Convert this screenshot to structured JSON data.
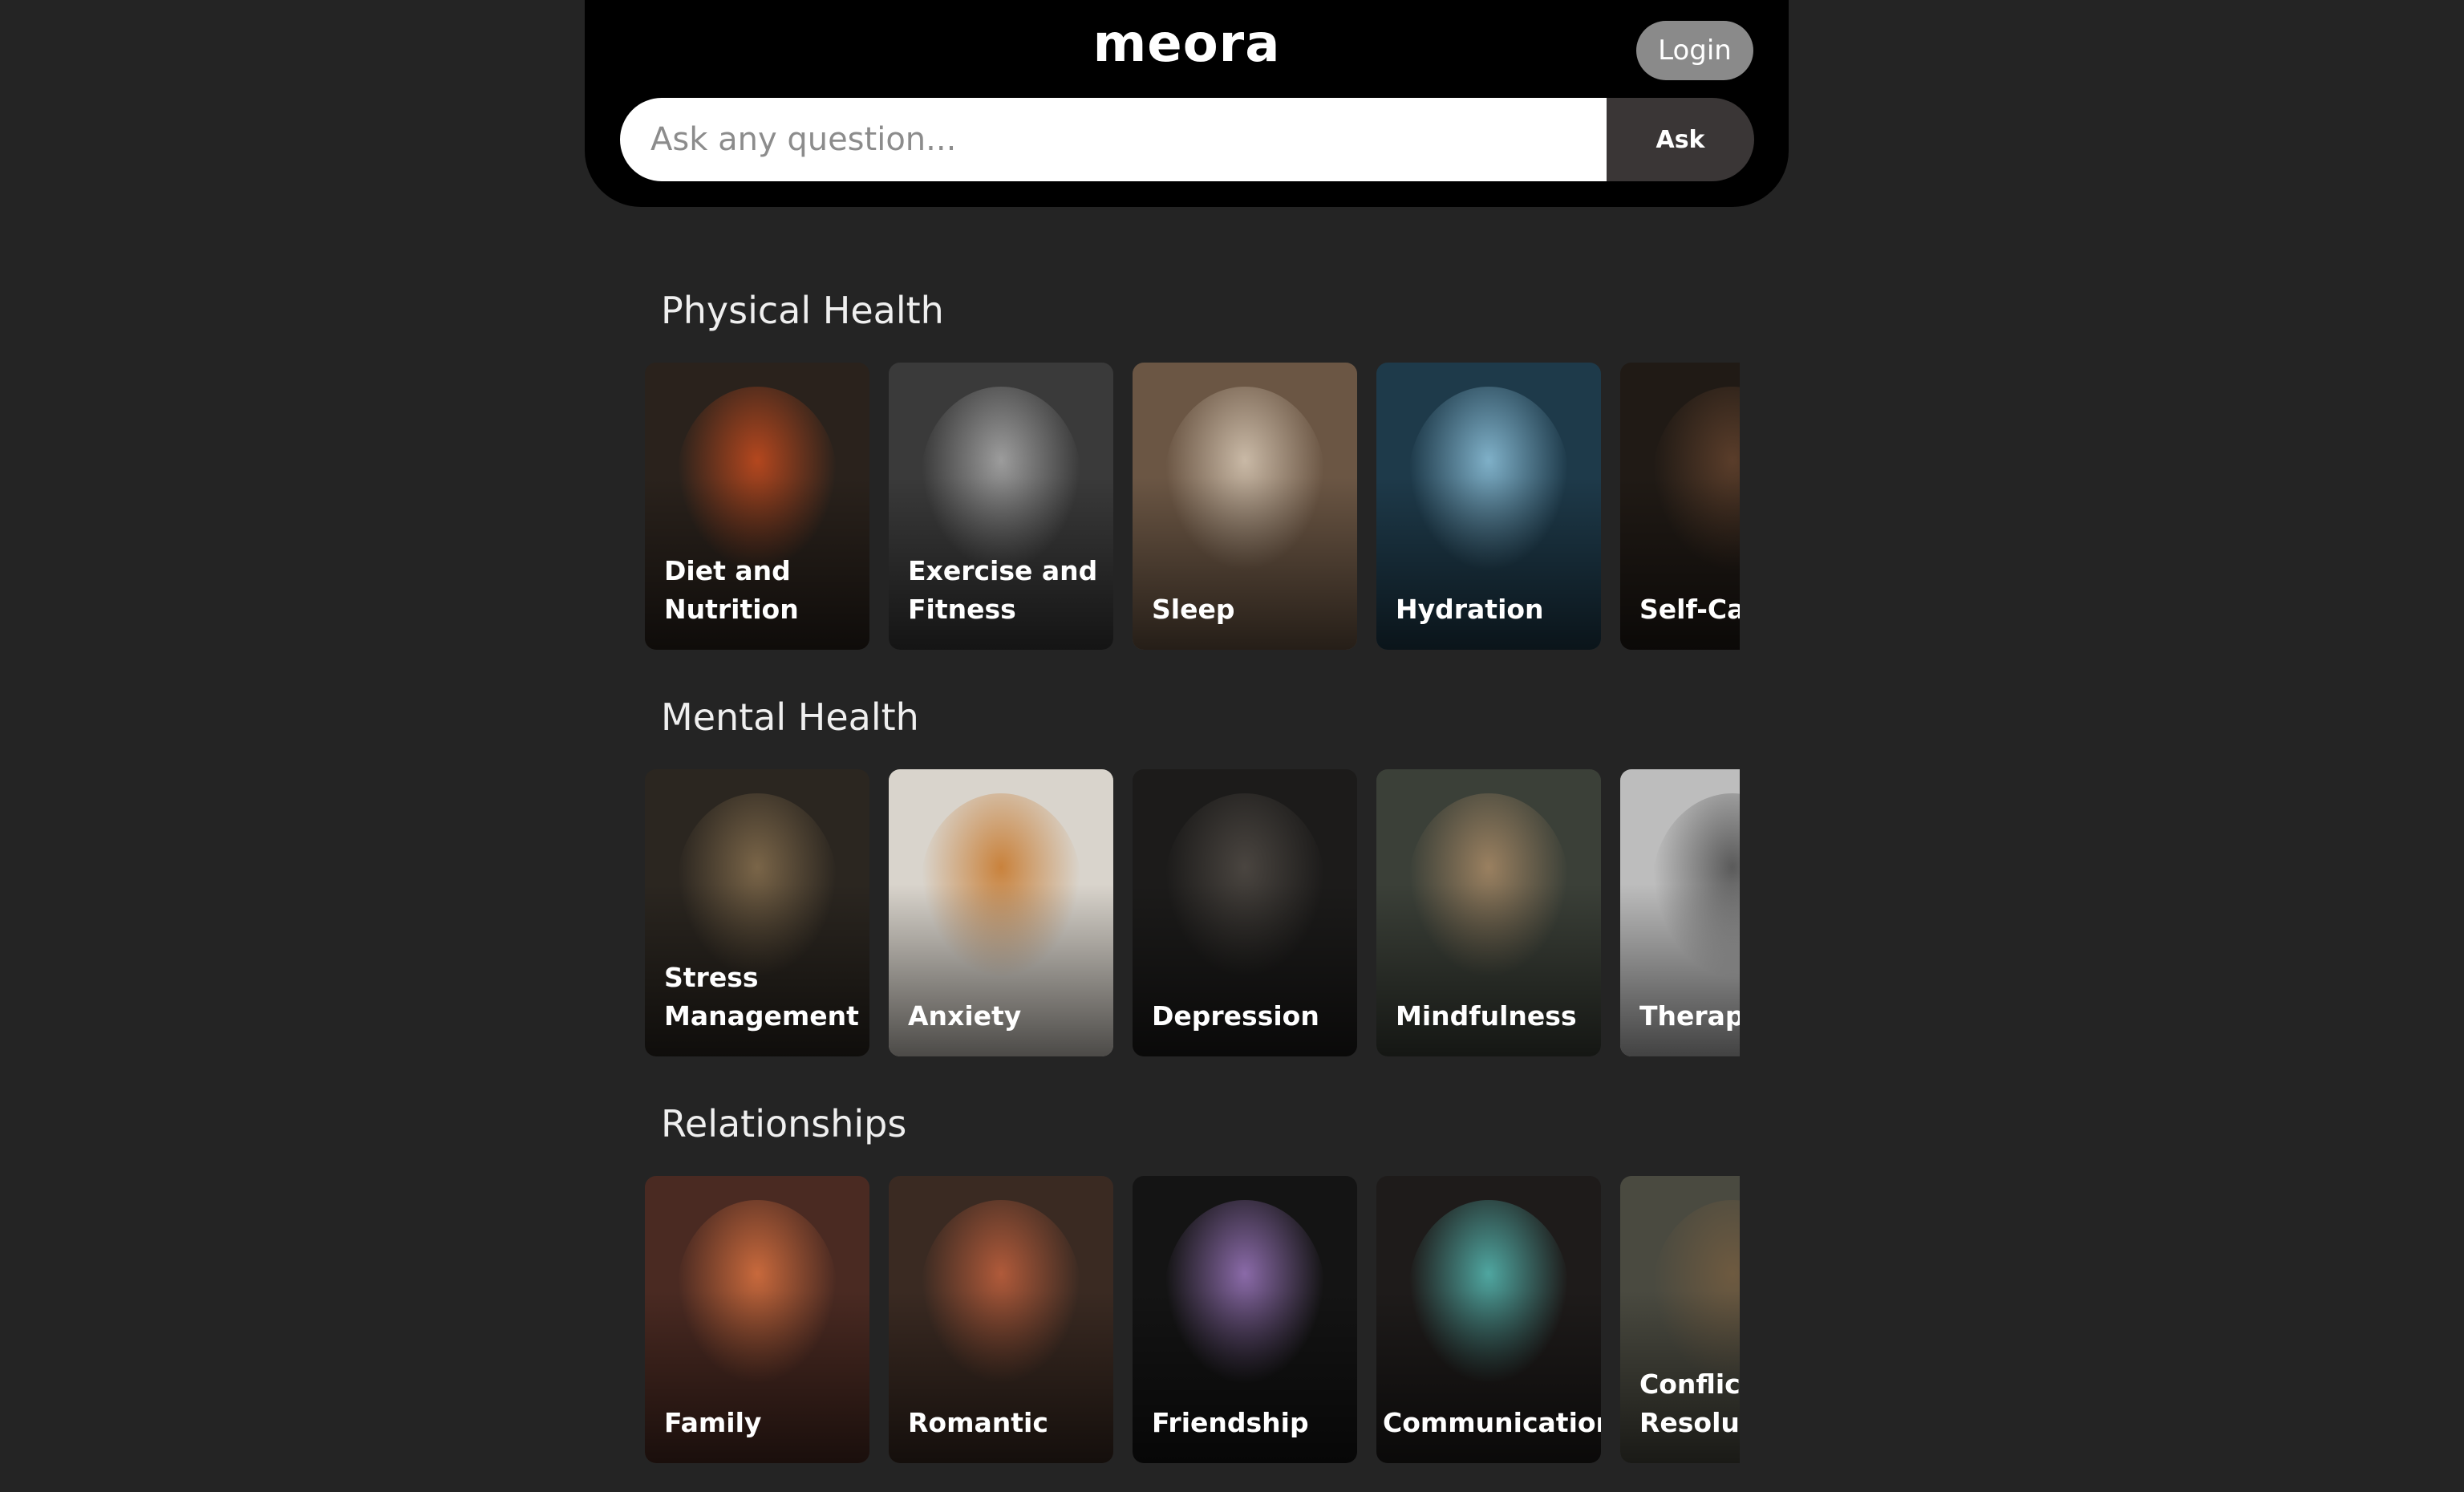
{
  "header": {
    "logo": "meora",
    "login_label": "Login",
    "search_placeholder": "Ask any question...",
    "ask_label": "Ask"
  },
  "sections": [
    {
      "title": "Physical Health",
      "cards": [
        {
          "label": "Diet and\nNutrition",
          "bg": "#2a221c",
          "accent": "#b4471e"
        },
        {
          "label": "Exercise and\nFitness",
          "bg": "#3a3a3a",
          "accent": "#9c9c9c"
        },
        {
          "label": "Sleep",
          "bg": "#6b5644",
          "accent": "#c9b9a6"
        },
        {
          "label": "Hydration",
          "bg": "#1e3a4a",
          "accent": "#7fb0c8"
        },
        {
          "label": "Self-Care",
          "bg": "#201a15",
          "accent": "#5a3d2a"
        }
      ]
    },
    {
      "title": "Mental Health",
      "cards": [
        {
          "label": "Stress\nManagement",
          "bg": "#2b2620",
          "accent": "#7a6548"
        },
        {
          "label": "Anxiety",
          "bg": "#d9d4cc",
          "accent": "#c9823c"
        },
        {
          "label": "Depression",
          "bg": "#1c1b1a",
          "accent": "#4a4540"
        },
        {
          "label": "Mindfulness",
          "bg": "#3b4038",
          "accent": "#9a8060"
        },
        {
          "label": "Therapy",
          "bg": "#bdbdbd",
          "accent": "#5a5a5a"
        }
      ]
    },
    {
      "title": "Relationships",
      "cards": [
        {
          "label": "Family",
          "bg": "#4a2a22",
          "accent": "#c8693c"
        },
        {
          "label": "Romantic",
          "bg": "#3a2a22",
          "accent": "#b05a3a"
        },
        {
          "label": "Friendship",
          "bg": "#141414",
          "accent": "#8a6aa8"
        },
        {
          "label": "Communication",
          "bg": "#1e1b1a",
          "accent": "#4fa6a0"
        },
        {
          "label": "Conflict\nResolution",
          "bg": "#4a4a40",
          "accent": "#6e5a40"
        }
      ]
    }
  ]
}
